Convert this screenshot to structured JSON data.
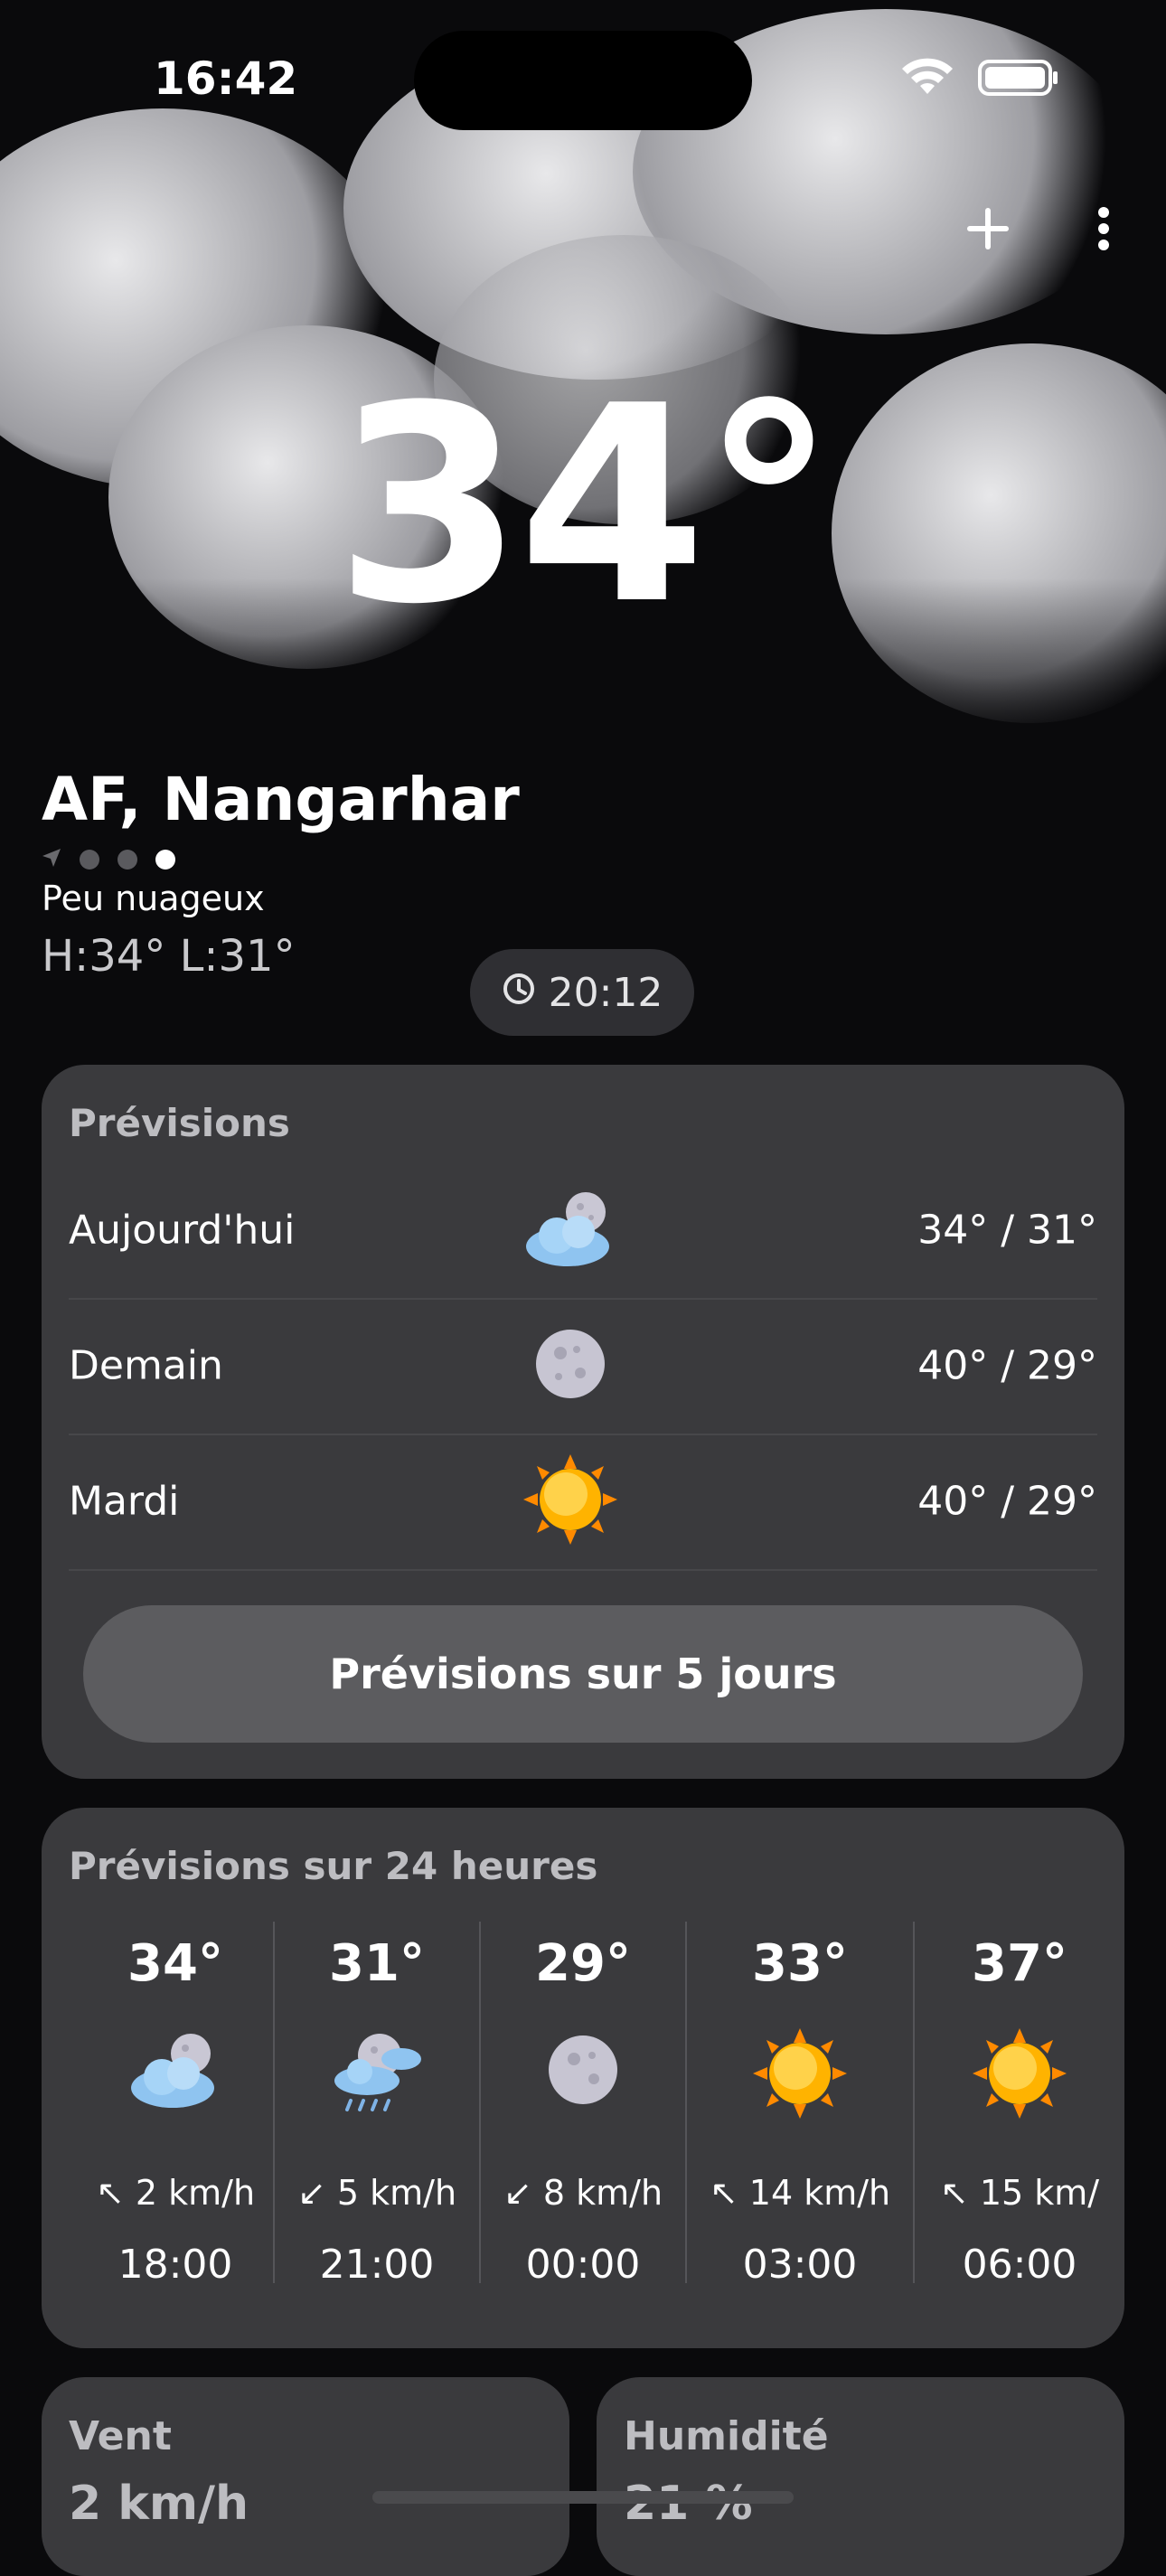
{
  "status": {
    "time": "16:42"
  },
  "weather": {
    "current_temp": "34°",
    "city": "AF, Nangarhar",
    "description": "Peu nuageux",
    "hilo": "H:34° L:31°",
    "updated_time": "20:12",
    "page_count": 4,
    "active_page": 4
  },
  "forecast": {
    "title": "Prévisions",
    "days": [
      {
        "day": "Aujourd'hui",
        "icon": "cloud-moon-icon",
        "temps": "34° / 31°"
      },
      {
        "day": "Demain",
        "icon": "moon-icon",
        "temps": "40° / 29°"
      },
      {
        "day": "Mardi",
        "icon": "sun-icon",
        "temps": "40° / 29°"
      }
    ],
    "five_day_label": "Prévisions sur 5 jours"
  },
  "hourly": {
    "title": "Prévisions sur 24 heures",
    "hours": [
      {
        "temp": "34°",
        "icon": "cloud-moon-icon",
        "wind": "2 km/h",
        "time": "18:00"
      },
      {
        "temp": "31°",
        "icon": "rain-cloud-moon-icon",
        "wind": "5 km/h",
        "time": "21:00"
      },
      {
        "temp": "29°",
        "icon": "moon-icon",
        "wind": "8 km/h",
        "time": "00:00"
      },
      {
        "temp": "33°",
        "icon": "sun-icon",
        "wind": "14 km/h",
        "time": "03:00"
      },
      {
        "temp": "37°",
        "icon": "sun-icon",
        "wind": "15 km/",
        "time": "06:00"
      }
    ]
  },
  "details": {
    "wind_label": "Vent",
    "wind_value": "2 km/h",
    "humidity_label": "Humidité",
    "humidity_value": "21 %"
  },
  "colors": {
    "background": "#0a0a0c",
    "card": "#3a3a3d",
    "button": "#5c5c5f"
  }
}
